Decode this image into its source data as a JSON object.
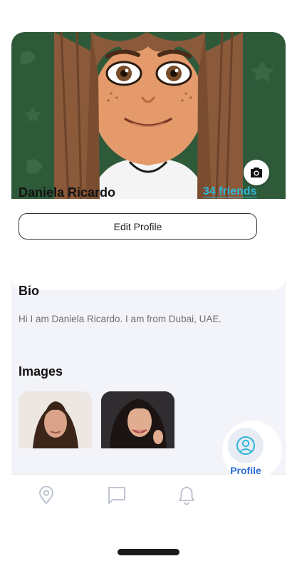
{
  "profile": {
    "name": "Daniela Ricardo",
    "friends_label": "34 friends",
    "edit_button_label": "Edit Profile"
  },
  "bio": {
    "title": "Bio",
    "text": "Hi I am Daniela Ricardo. I am from Dubai, UAE."
  },
  "images": {
    "title": "Images"
  },
  "nav": {
    "items": [
      {
        "icon": "location-pin-icon"
      },
      {
        "icon": "chat-bubble-icon"
      },
      {
        "icon": "bell-icon"
      },
      {
        "icon": "user-circle-icon",
        "label": "Profile",
        "active": true
      }
    ]
  },
  "colors": {
    "accent": "#2fb6d8",
    "nav_active": "#2c6bd6",
    "cover_background": "#2e5a3a",
    "section_background": "#f3f4f9"
  }
}
